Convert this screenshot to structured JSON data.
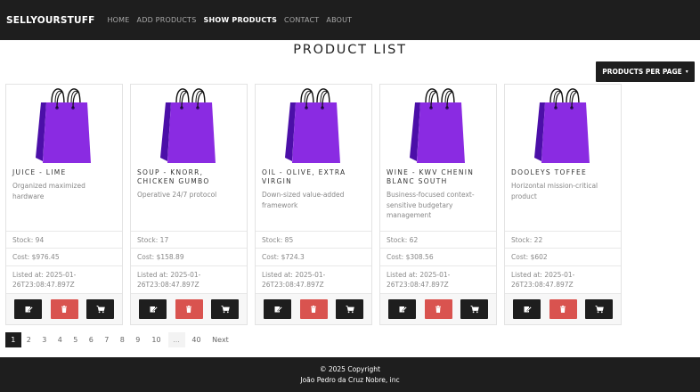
{
  "navbar": {
    "brand": "SELLYOURSTUFF",
    "links": [
      {
        "label": "HOME",
        "active": false
      },
      {
        "label": "ADD PRODUCTS",
        "active": false
      },
      {
        "label": "SHOW PRODUCTS",
        "active": true
      },
      {
        "label": "CONTACT",
        "active": false
      },
      {
        "label": "ABOUT",
        "active": false
      }
    ]
  },
  "page_title": "PRODUCT LIST",
  "per_page_button": {
    "label": "PRODUCTS PER PAGE",
    "caret": "▾"
  },
  "product_image": {
    "icon": "shopping-bag-icon",
    "color": "#8a2be2"
  },
  "products": [
    {
      "title": "JUICE - LIME",
      "description": "Organized maximized hardware",
      "stock": "Stock: 94",
      "cost": "Cost: $976.45",
      "listed": "Listed at: 2025-01-26T23:08:47.897Z"
    },
    {
      "title": "SOUP - KNORR, CHICKEN GUMBO",
      "description": "Operative 24/7 protocol",
      "stock": "Stock: 17",
      "cost": "Cost: $158.89",
      "listed": "Listed at: 2025-01-26T23:08:47.897Z"
    },
    {
      "title": "OIL - OLIVE, EXTRA VIRGIN",
      "description": "Down-sized value-added framework",
      "stock": "Stock: 85",
      "cost": "Cost: $724.3",
      "listed": "Listed at: 2025-01-26T23:08:47.897Z"
    },
    {
      "title": "WINE - KWV CHENIN BLANC SOUTH",
      "description": "Business-focused context-sensitive budgetary management",
      "stock": "Stock: 62",
      "cost": "Cost: $308.56",
      "listed": "Listed at: 2025-01-26T23:08:47.897Z"
    },
    {
      "title": "DOOLEYS TOFFEE",
      "description": "Horizontal mission-critical product",
      "stock": "Stock: 22",
      "cost": "Cost: $602",
      "listed": "Listed at: 2025-01-26T23:08:47.897Z"
    }
  ],
  "card_actions": {
    "edit_icon": "edit-icon",
    "delete_icon": "trash-icon",
    "cart_icon": "cart-icon",
    "danger_color": "#d9534f"
  },
  "pagination": {
    "pages": [
      "1",
      "2",
      "3",
      "4",
      "5",
      "6",
      "7",
      "8",
      "9",
      "10"
    ],
    "gap": "...",
    "last": "40",
    "next": "Next",
    "current": "1"
  },
  "footer": {
    "copyright": "© 2025 Copyright",
    "author": "João Pedro da Cruz Nobre, inc"
  }
}
